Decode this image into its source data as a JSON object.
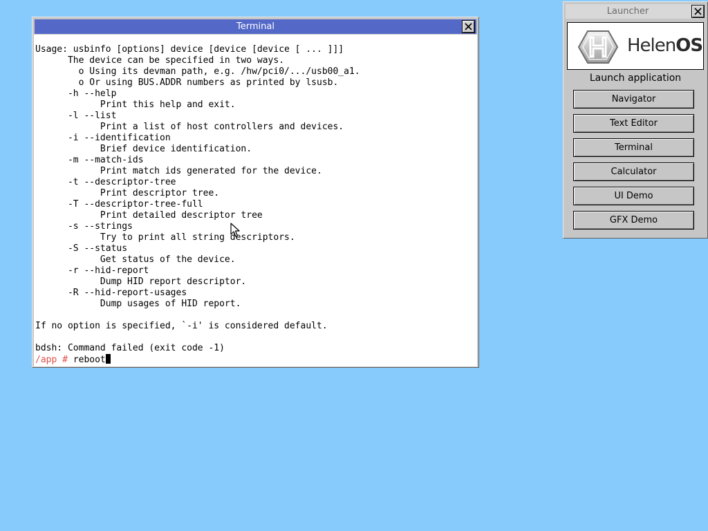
{
  "terminal": {
    "title": "Terminal",
    "output": "Usage: usbinfo [options] device [device [device [ ... ]]]\n      The device can be specified in two ways.\n        o Using its devman path, e.g. /hw/pci0/.../usb00_a1.\n        o Or using BUS.ADDR numbers as printed by lsusb.\n      -h --help\n            Print this help and exit.\n      -l --list\n            Print a list of host controllers and devices.\n      -i --identification\n            Brief device identification.\n      -m --match-ids\n            Print match ids generated for the device.\n      -t --descriptor-tree\n            Print descriptor tree.\n      -T --descriptor-tree-full\n            Print detailed descriptor tree\n      -s --strings\n            Try to print all string descriptors.\n      -S --status\n            Get status of the device.\n      -r --hid-report\n            Dump HID report descriptor.\n      -R --hid-report-usages\n            Dump usages of HID report.\n\nIf no option is specified, `-i' is considered default.\n\nbdsh: Command failed (exit code -1)",
    "prompt_path": "/app # ",
    "prompt_input": "reboot",
    "prompt_color": "#e0504a"
  },
  "launcher": {
    "title": "Launcher",
    "logo_text": "Helen",
    "logo_text_bold": "OS",
    "heading": "Launch application",
    "buttons": [
      {
        "label": "Navigator"
      },
      {
        "label": "Text Editor"
      },
      {
        "label": "Terminal"
      },
      {
        "label": "Calculator"
      },
      {
        "label": "UI Demo"
      },
      {
        "label": "GFX Demo"
      }
    ]
  },
  "theme": {
    "desktop_background": "#87cbfc",
    "active_titlebar": "#5468c8",
    "inactive_titlebar": "#d8d8d8",
    "window_face": "#c6c6c6"
  },
  "icons": {
    "close": "close-icon",
    "pointer": "mouse-pointer-icon",
    "logo": "helenos-logo-icon"
  }
}
